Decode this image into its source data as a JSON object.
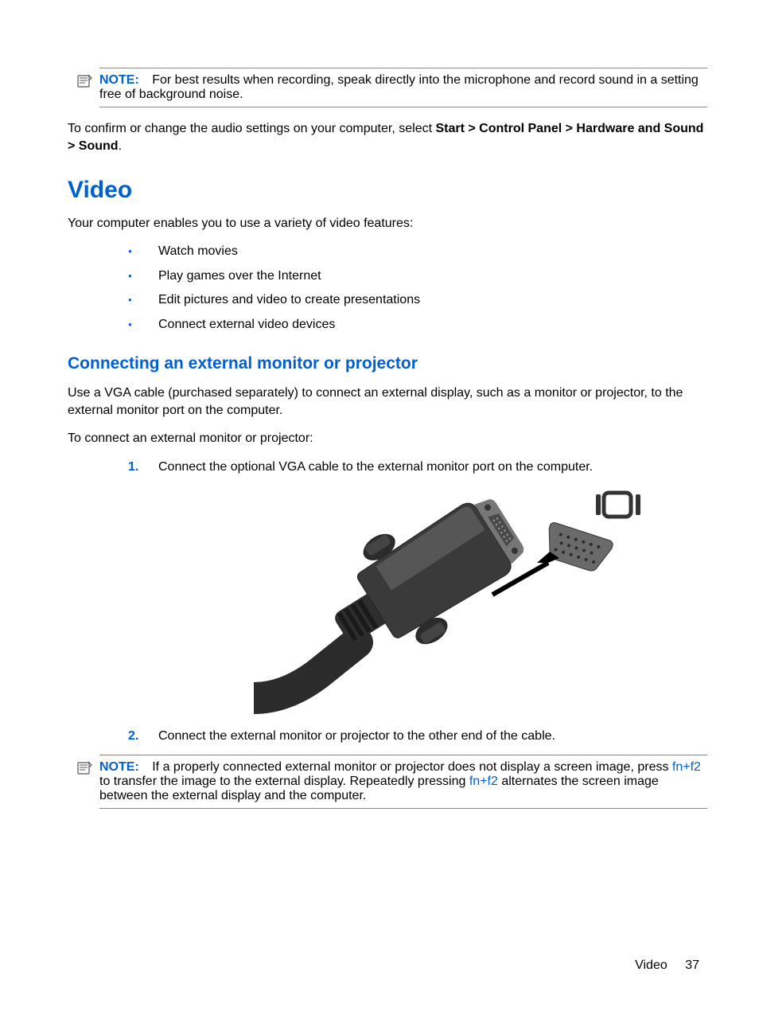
{
  "note1": {
    "label": "NOTE:",
    "text": "For best results when recording, speak directly into the microphone and record sound in a setting free of background noise."
  },
  "para1": {
    "pre": "To confirm or change the audio settings on your computer, select ",
    "bold": "Start > Control Panel > Hardware and Sound > Sound",
    "post": "."
  },
  "h1": "Video",
  "para2": "Your computer enables you to use a variety of video features:",
  "bullets": [
    "Watch movies",
    "Play games over the Internet",
    "Edit pictures and video to create presentations",
    "Connect external video devices"
  ],
  "h2": "Connecting an external monitor or projector",
  "para3": "Use a VGA cable (purchased separately) to connect an external display, such as a monitor or projector, to the external monitor port on the computer.",
  "para4": "To connect an external monitor or projector:",
  "steps": {
    "n1": "1.",
    "t1": "Connect the optional VGA cable to the external monitor port on the computer.",
    "n2": "2.",
    "t2": "Connect the external monitor or projector to the other end of the cable."
  },
  "note2": {
    "label": "NOTE:",
    "seg1": "If a properly connected external monitor or projector does not display a screen image, press ",
    "key1": "fn+f2",
    "seg2": " to transfer the image to the external display. Repeatedly pressing ",
    "key2": "fn+f2",
    "seg3": " alternates the screen image between the external display and the computer."
  },
  "footer": {
    "section": "Video",
    "page": "37"
  }
}
